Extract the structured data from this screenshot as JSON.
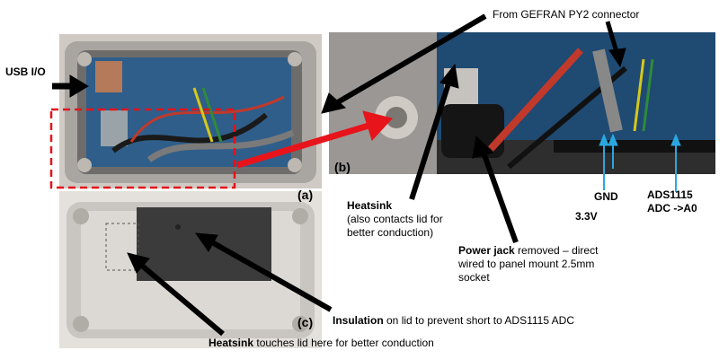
{
  "labels": {
    "usb_io": "USB I/O",
    "from_connector": "From  GEFRAN PY2 connector",
    "heatsink_bold": "Heatsink",
    "heatsink_rest1": "(also contacts lid for",
    "heatsink_rest2": "better conduction)",
    "gnd": "GND",
    "v33": "3.3V",
    "ads_line1": "ADS1115",
    "ads_line2": "ADC ->A0",
    "power_bold": "Power jack",
    "power_rest1": " removed – direct",
    "power_rest2": "wired to panel mount 2.5mm",
    "power_rest3": "socket",
    "insulation_bold": "Insulation",
    "insulation_rest": " on lid to prevent short to ADS1115  ADC",
    "heatsink2_bold": "Heatsink",
    "heatsink2_rest": " touches lid here for better conduction"
  },
  "panels": {
    "a": "(a)",
    "b": "(b)",
    "c": "(c)"
  },
  "colors": {
    "arrow_black": "#000000",
    "arrow_red": "#e8141b",
    "arrow_blue": "#2aa7e0",
    "dashed_red": "#e3131b"
  }
}
